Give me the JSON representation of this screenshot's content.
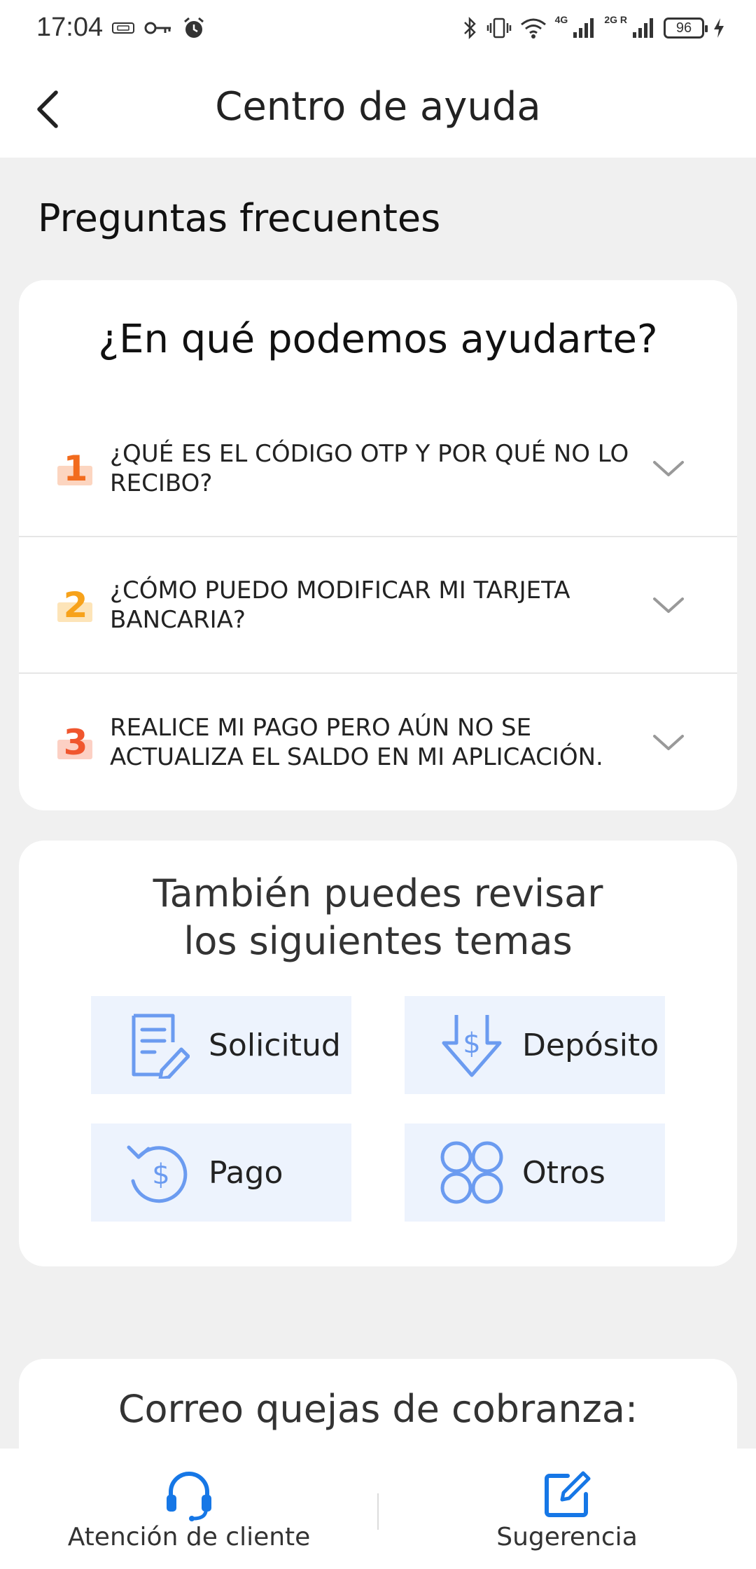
{
  "status_bar": {
    "time": "17:04",
    "net_4g": "4G",
    "net_2g": "2G R",
    "battery": "96"
  },
  "header": {
    "title": "Centro de ayuda"
  },
  "faq": {
    "section_title": "Preguntas frecuentes",
    "heading": "¿En qué podemos ayudarte?",
    "items": [
      {
        "number": "1",
        "question": "¿QUÉ ES EL CÓDIGO OTP Y POR QUÉ NO LO RECIBO?",
        "number_color": "#f26b1d",
        "badge_color": "#fcd5c0"
      },
      {
        "number": "2",
        "question": "¿CÓMO PUEDO MODIFICAR MI TARJETA BANCARIA?",
        "number_color": "#f7a21b",
        "badge_color": "#fde4b8"
      },
      {
        "number": "3",
        "question": "REALICE MI PAGO PERO AÚN NO SE ACTUALIZA EL SALDO EN MI APLICACIÓN.",
        "number_color": "#f0562e",
        "badge_color": "#fcd0c4"
      }
    ]
  },
  "topics": {
    "heading": "También puedes revisar los siguientes temas",
    "items": [
      {
        "label": "Solicitud",
        "icon": "document-edit-icon"
      },
      {
        "label": "Depósito",
        "icon": "deposit-arrow-icon"
      },
      {
        "label": "Pago",
        "icon": "payment-refresh-icon"
      },
      {
        "label": "Otros",
        "icon": "grid-circles-icon"
      }
    ]
  },
  "mail": {
    "heading": "Correo quejas de cobranza:"
  },
  "bottom_bar": {
    "left_label": "Atención de cliente",
    "right_label": "Sugerencia"
  },
  "colors": {
    "accent_blue": "#1677e6",
    "topic_icon_blue": "#6b9bf0",
    "topic_bg": "#edf3fd",
    "page_bg": "#f0f0f0"
  }
}
